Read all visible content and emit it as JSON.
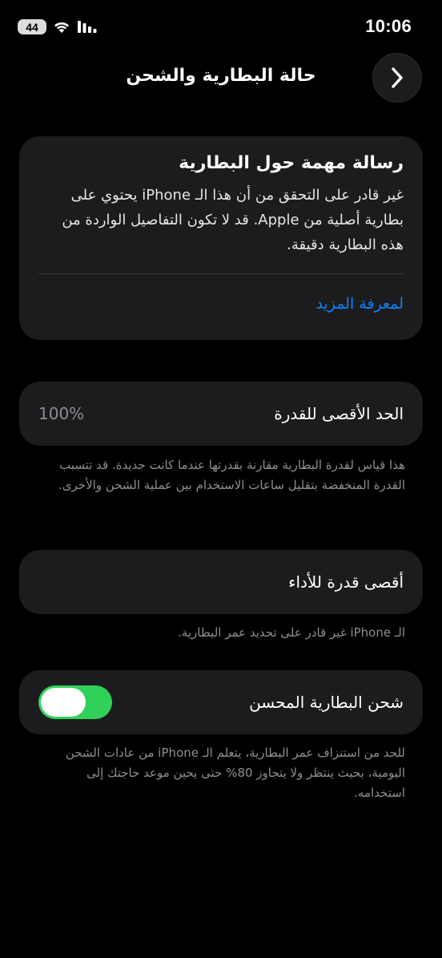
{
  "status_bar": {
    "time": "10:06",
    "battery": "44",
    "icons": [
      "battery-icon",
      "wifi-icon",
      "cellular-signal-icon"
    ]
  },
  "nav": {
    "title": "حالة البطارية والشحن",
    "back_icon": "chevron-right-icon"
  },
  "notice": {
    "title": "رسالة مهمة حول البطارية",
    "body": "غير قادر على التحقق من أن هذا الـ iPhone يحتوي على بطارية أصلية من Apple. قد لا تكون التفاصيل الواردة من هذه البطارية دقيقة.",
    "link": "لمعرفة المزيد"
  },
  "maximum_capacity": {
    "label": "الحد الأقصى للقدرة",
    "value": "100%",
    "footnote": "هذا قياس لقدرة البطارية مقارنة بقدرتها عندما كانت جديدة. قد تتسبب القدرة المنخفضة بتقليل ساعات الاستخدام بين عملية الشحن والأخرى."
  },
  "peak_performance": {
    "label": "أقصى قدرة للأداء",
    "footnote": "الـ iPhone غير قادر على تحديد عمر البطارية."
  },
  "optimized_charging": {
    "label": "شحن البطارية المحسن",
    "enabled": true,
    "footnote": "للحد من استنزاف عمر البطارية، يتعلم الـ iPhone من عادات الشحن اليومية، بحيث ينتظر ولا يتجاوز 80% حتى يحين موعد حاجتك إلى استخدامه."
  },
  "colors": {
    "background": "#000000",
    "card": "#1c1c1e",
    "link": "#0a84ff",
    "toggle_on": "#30d158",
    "secondary_text": "#8e8e93"
  }
}
